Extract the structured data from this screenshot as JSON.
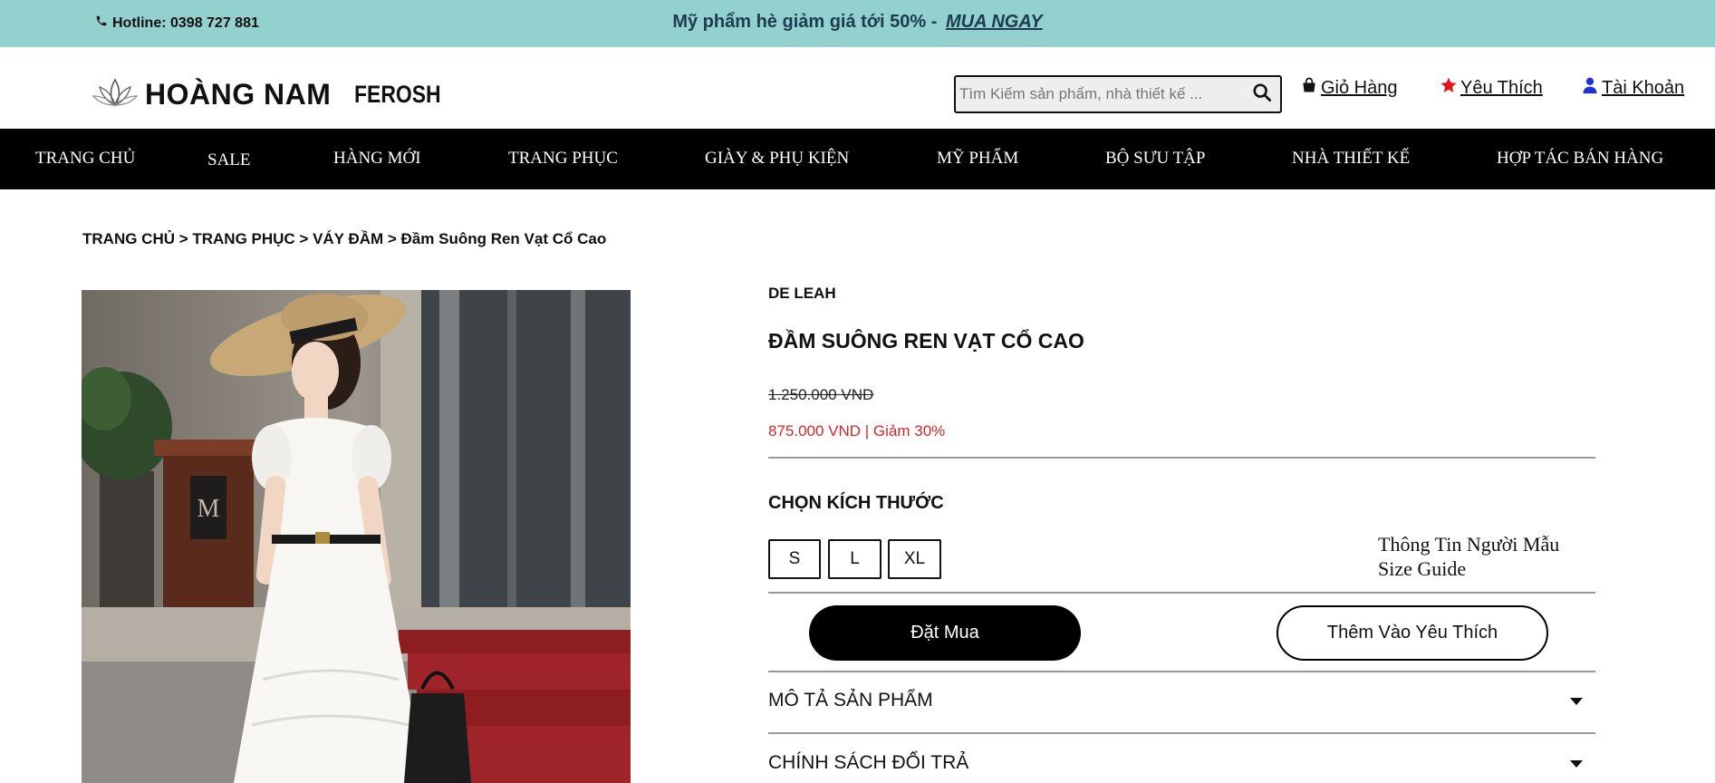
{
  "topbar": {
    "hotline": "Hotline: 0398 727 881",
    "promo_text": "Mỹ phẩm hè giảm giá tới 50% -",
    "promo_cta": "MUA NGAY",
    "background": "#93d1cf"
  },
  "header": {
    "logo_text": "HOÀNG NAM",
    "logo_sub": "FEROSH",
    "search_placeholder": "Tìm Kiếm sản phẩm, nhà thiết kế ...",
    "cart_label": " Giỏ Hàng",
    "wishlist_label": " Yêu Thích",
    "account_label": " Tài Khoản",
    "icons": {
      "phone": "phone-icon",
      "search": "search-icon",
      "cart": "shopping-bag-icon",
      "wishlist": "star-icon",
      "account": "user-icon"
    },
    "icon_colors": {
      "wishlist": "#e8141b",
      "account": "#2133d6"
    }
  },
  "nav": {
    "items": [
      "TRANG CHỦ",
      "SALE",
      "HÀNG MỚI",
      "TRANG PHỤC",
      "GIÀY & PHỤ KIỆN",
      "MỸ PHẨM",
      "BỘ SƯU TẬP",
      "NHÀ THIẾT KẾ",
      "HỢP TÁC BÁN HÀNG"
    ]
  },
  "breadcrumb": "TRANG CHỦ > TRANG PHỤC > VÁY ĐẦM > Đầm Suông Ren Vạt Cổ Cao",
  "product": {
    "brand": "DE LEAH",
    "title": "ĐẦM SUÔNG REN VẠT CỔ CAO",
    "old_price": "1.250.000 VND",
    "new_price": "875.000 VND | Giảm 30%",
    "price_color": "#d6262a",
    "size_title": "CHỌN KÍCH THƯỚC",
    "sizes": [
      "S",
      "L",
      "XL"
    ],
    "model_info": "Thông Tin Người Mẫu",
    "size_guide": "Size Guide",
    "buy_label": "Đặt Mua",
    "fav_label": "Thêm Vào Yêu Thích",
    "accordion": [
      {
        "label": "MÔ TẢ SẢN PHẨM"
      },
      {
        "label": "CHÍNH SÁCH ĐỔI TRẢ"
      }
    ]
  }
}
